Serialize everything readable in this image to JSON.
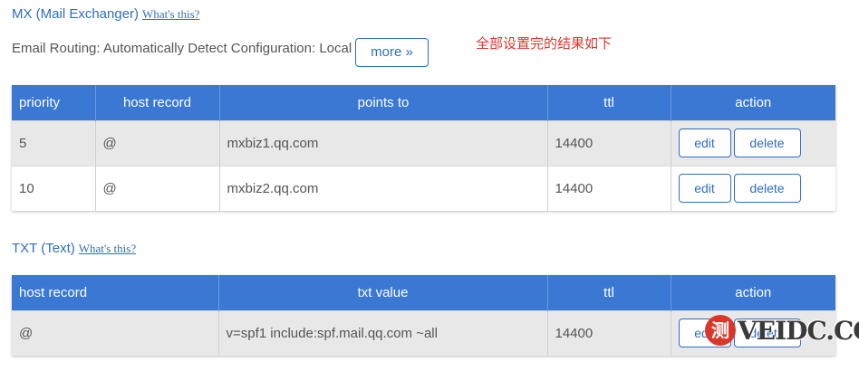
{
  "mx": {
    "title": "MX (Mail Exchanger)",
    "help_link": "What's this?",
    "routing_text": "Email Routing: Automatically Detect Configuration: Local",
    "more_label": "more »",
    "note": "全部设置完的结果如下",
    "headers": [
      "priority",
      "host record",
      "points to",
      "ttl",
      "action"
    ],
    "rows": [
      {
        "priority": "5",
        "host": "@",
        "points_to": "mxbiz1.qq.com",
        "ttl": "14400",
        "edit": "edit",
        "delete": "delete"
      },
      {
        "priority": "10",
        "host": "@",
        "points_to": "mxbiz2.qq.com",
        "ttl": "14400",
        "edit": "edit",
        "delete": "delete"
      }
    ]
  },
  "txt": {
    "title": "TXT (Text)",
    "help_link": "What's this?",
    "headers": [
      "host record",
      "txt value",
      "ttl",
      "action"
    ],
    "rows": [
      {
        "host": "@",
        "value": "v=spf1 include:spf.mail.qq.com ~all",
        "ttl": "14400",
        "edit": "edit",
        "delete": "delete"
      }
    ]
  },
  "watermark": {
    "seal": "测",
    "text": "VEIDC.COM"
  },
  "colors": {
    "header_bg": "#3a78d4",
    "link": "#2f6ebf",
    "note": "#d9372b"
  }
}
